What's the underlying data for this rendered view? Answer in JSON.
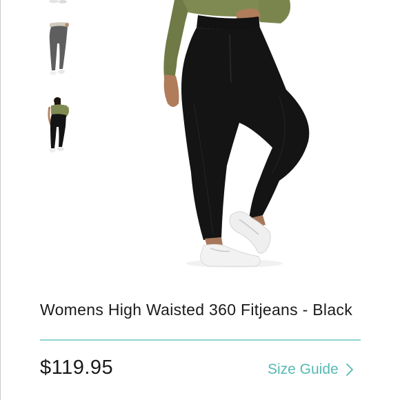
{
  "product": {
    "title": "Womens High Waisted 360 Fitjeans - Black",
    "price": "$119.95",
    "size_guide_label": "Size Guide"
  },
  "gallery": {
    "thumbnails": [
      {
        "name": "thumbnail-white-shoes"
      },
      {
        "name": "thumbnail-grey-leggings"
      },
      {
        "name": "thumbnail-black-leggings-olive-top"
      }
    ],
    "main_image": "product-photo-black-leggings"
  },
  "colors": {
    "accent": "#55b9b2",
    "divider": "#8fd3cf",
    "text": "#1a1a1a",
    "top_olive": "#7f8a52",
    "leggings_black": "#141414",
    "grey_leggings": "#5e5e5e"
  },
  "icons": {
    "size_guide": "chevron-right-icon"
  }
}
